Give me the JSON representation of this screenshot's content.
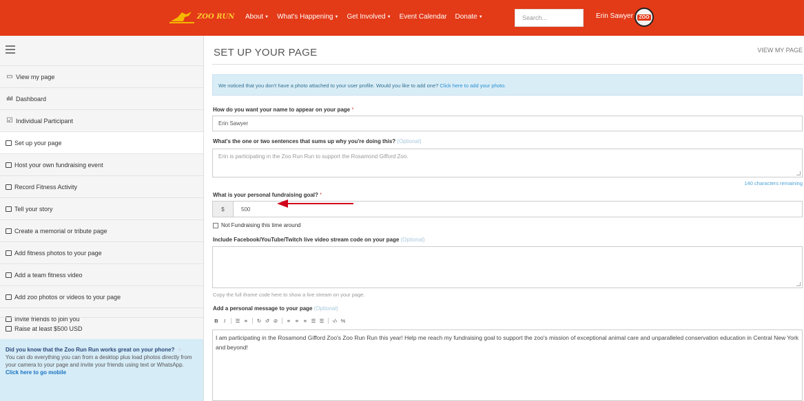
{
  "brand": {
    "logo_text": "ZOO RUN"
  },
  "nav": {
    "items": [
      {
        "label": "About",
        "dropdown": true
      },
      {
        "label": "What's Happening",
        "dropdown": true
      },
      {
        "label": "Get Involved",
        "dropdown": true
      },
      {
        "label": "Event Calendar",
        "dropdown": false
      },
      {
        "label": "Donate",
        "dropdown": true
      }
    ],
    "search_placeholder": "Search...",
    "user_name": "Erin Sawyer",
    "avatar_text": "ZOO"
  },
  "sidebar": {
    "items": [
      {
        "label": "View my page",
        "icon": "monitor-icon"
      },
      {
        "label": "Dashboard",
        "icon": "bar-chart-icon"
      },
      {
        "label": "Individual Participant",
        "icon": "checked-box-icon"
      },
      {
        "label": "Set up your page",
        "icon": "checkbox-icon"
      },
      {
        "label": "Host your own fundraising event",
        "icon": "checkbox-icon"
      },
      {
        "label": "Record Fitness Activity",
        "icon": "checkbox-icon"
      },
      {
        "label": "Tell your story",
        "icon": "checkbox-icon"
      },
      {
        "label": "Create a memorial or tribute page",
        "icon": "checkbox-icon"
      },
      {
        "label": "Add fitness photos to your page",
        "icon": "checkbox-icon"
      },
      {
        "label": "Add a team fitness video",
        "icon": "checkbox-icon"
      },
      {
        "label": "Add zoo photos or videos to your page",
        "icon": "checkbox-icon"
      },
      {
        "label": "Invite friends to join you",
        "icon": "checkbox-icon"
      },
      {
        "label": "Raise at least $500 USD",
        "icon": "checkbox-icon"
      }
    ],
    "promo": {
      "heading": "Did you know that the Zoo Run Run works great on your phone?",
      "body": "You can do everything you can from a desktop plus load photos directly from your camera to your page and invite your friends using text or WhatsApp.",
      "link": "Click here to go mobile"
    }
  },
  "main": {
    "title": "SET UP YOUR PAGE",
    "view_link": "VIEW MY PAGE",
    "alert_text": "We noticed that you don't have a photo attached to your user profile. Would you like to add one?",
    "alert_link": "Click here to add your photo.",
    "name_label": "How do you want your name to appear on your page",
    "name_value": "Erin Sawyer",
    "summary_label": "What's the one or two sentences that sums up why you're doing this?",
    "summary_placeholder": "Erin is participating in the Zoo Run Run to support the Rosamond Gifford Zoo.",
    "chars_remaining": "140 characters remaining",
    "goal_label": "What is your personal fundraising goal?",
    "currency_symbol": "$",
    "goal_value": "500",
    "not_fundraising_label": "Not Fundraising this time around",
    "stream_label": "Include Facebook/YouTube/Twitch live video stream code on your page",
    "stream_hint": "Copy the full iframe code here to show a live stream on your page.",
    "message_label": "Add a personal message to your page",
    "message_text": "I am participating in the Rosamond Gifford Zoo's Zoo Run Run this year! Help me reach my fundraising goal to support the zoo's mission of exceptional animal care and unparalleled conservation education in Central New York and beyond!",
    "optional_tag": "(Optional)",
    "required_mark": "*"
  },
  "colors": {
    "nav_bg": "#e33a18",
    "alert_bg": "#d9edf7",
    "arrow": "#d0021b"
  }
}
